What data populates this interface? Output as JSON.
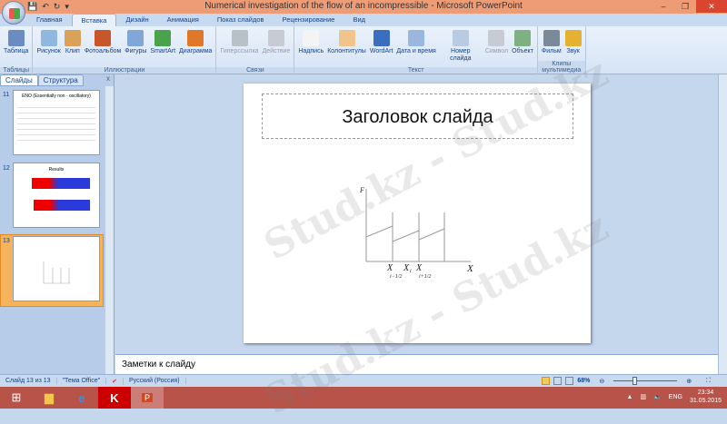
{
  "window": {
    "title": "Numerical investigation of the flow of an incompressible - Microsoft PowerPoint",
    "minimize": "–",
    "restore": "❐",
    "close": "✕"
  },
  "qat": {
    "save": "💾",
    "undo": "↶",
    "redo": "↻",
    "customize": "▾"
  },
  "tabs": [
    "Главная",
    "Вставка",
    "Дизайн",
    "Анимация",
    "Показ слайдов",
    "Рецензирование",
    "Вид"
  ],
  "ribbon": {
    "groups": [
      {
        "label": "Таблицы",
        "buttons": [
          {
            "label": "Таблица",
            "color": "#6a8cc0"
          }
        ]
      },
      {
        "label": "Иллюстрации",
        "buttons": [
          {
            "label": "Рисунок",
            "color": "#8fb7e0"
          },
          {
            "label": "Клип",
            "color": "#d9a15a"
          },
          {
            "label": "Фотоальбом",
            "color": "#c9552a"
          },
          {
            "label": "Фигуры",
            "color": "#7fa8d8"
          },
          {
            "label": "SmartArt",
            "color": "#4aa34a"
          },
          {
            "label": "Диаграмма",
            "color": "#e0782a"
          }
        ]
      },
      {
        "label": "Связи",
        "buttons": [
          {
            "label": "Гиперссылка",
            "color": "#b8c0c8",
            "disabled": true
          },
          {
            "label": "Действие",
            "color": "#c8ccd2",
            "disabled": true
          }
        ]
      },
      {
        "label": "Текст",
        "buttons": [
          {
            "label": "Надпись",
            "color": "#f4f4f4"
          },
          {
            "label": "Колонтитулы",
            "color": "#f0c48a"
          },
          {
            "label": "WordArt",
            "color": "#3a6fc0"
          },
          {
            "label": "Дата и время",
            "color": "#9ab8de"
          },
          {
            "label": "Номер слайда",
            "color": "#b9cbe3"
          },
          {
            "label": "Символ",
            "color": "#c8ccd2",
            "disabled": true
          },
          {
            "label": "Объект",
            "color": "#7fb07f"
          }
        ]
      },
      {
        "label": "Клипы мультимедиа",
        "buttons": [
          {
            "label": "Фильм",
            "color": "#7a8a9a"
          },
          {
            "label": "Звук",
            "color": "#e6b030"
          }
        ]
      }
    ]
  },
  "left_pane": {
    "tabs": [
      "Слайды",
      "Структура"
    ],
    "close": "x",
    "slides": [
      {
        "number": "11",
        "title": "ENO (Essentially non - oscillatory)"
      },
      {
        "number": "12",
        "title": "Results"
      },
      {
        "number": "13",
        "title": ""
      }
    ]
  },
  "slide": {
    "title_placeholder": "Заголовок слайда",
    "diagram": {
      "y_label": "F",
      "x_label": "X",
      "ticks": [
        "X",
        "i−1/2",
        "X",
        "i",
        "X",
        "i+1/2"
      ]
    }
  },
  "notes": {
    "placeholder": "Заметки к слайду"
  },
  "status": {
    "slide": "Слайд 13 из 13",
    "theme": "\"Тема Office\"",
    "language": "Русский (Россия)",
    "zoom": "68%",
    "zoom_level": 68
  },
  "taskbar": {
    "lang": "ENG",
    "time": "23:34",
    "date": "31.05.2015"
  },
  "watermark": "Stud.kz - Stud.kz"
}
